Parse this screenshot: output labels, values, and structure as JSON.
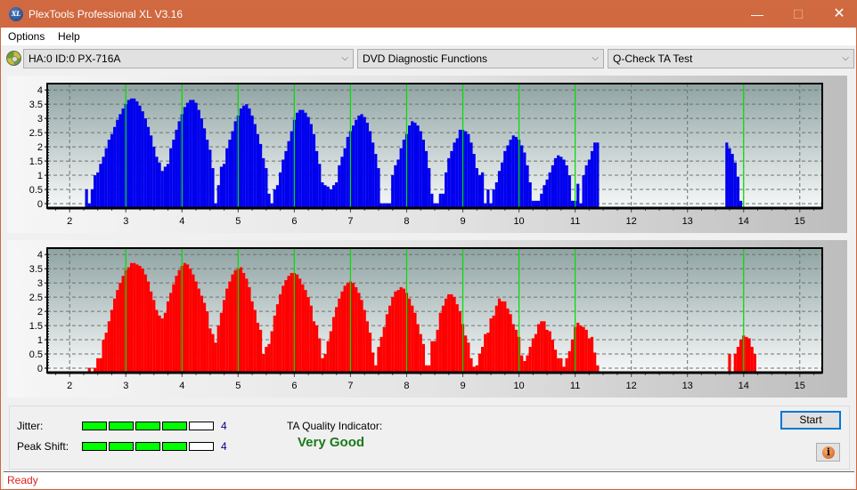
{
  "window": {
    "title": "PlexTools Professional XL V3.16",
    "app_icon": "xl-logo-icon",
    "controls": {
      "minimize": "—",
      "maximize": "☐",
      "close": "✕"
    }
  },
  "menu": {
    "items": [
      "Options",
      "Help"
    ]
  },
  "toolbar": {
    "drive_icon": "cd-drive-icon",
    "drive_select": "HA:0 ID:0  PX-716A",
    "function_select": "DVD Diagnostic Functions",
    "test_select": "Q-Check TA Test",
    "chevron": "⌵"
  },
  "colors": {
    "titlebar": "#d06840",
    "top_bars": "#0000ee",
    "bottom_bars": "#ff0000",
    "marker_lines": "#00e000",
    "meter_on": "#00ff00",
    "quality_text": "#1a7a1a",
    "status_text": "#e02020"
  },
  "chart_data": [
    {
      "type": "bar",
      "name": "ta-top-chart",
      "title": "",
      "xlabel": "",
      "ylabel": "",
      "xlim": [
        1.6,
        15.4
      ],
      "ylim": [
        -0.1,
        4.1
      ],
      "xticks": [
        2,
        3,
        4,
        5,
        6,
        7,
        8,
        9,
        10,
        11,
        12,
        13,
        14,
        15
      ],
      "yticks": [
        0,
        0.5,
        1,
        1.5,
        2,
        2.5,
        3,
        3.5,
        4
      ],
      "ytick_labels": [
        "0",
        "0.5",
        "1",
        "1.5",
        "2",
        "2.5",
        "3",
        "3.5",
        "4"
      ],
      "grid": true,
      "marker_lines": [
        3,
        4,
        5,
        6,
        7,
        8,
        9,
        10,
        11,
        14
      ],
      "bar_color": "#0000ee",
      "x": [
        2.3,
        2.35,
        2.4,
        2.45,
        2.5,
        2.55,
        2.6,
        2.65,
        2.7,
        2.75,
        2.8,
        2.85,
        2.9,
        2.95,
        3.0,
        3.05,
        3.1,
        3.15,
        3.2,
        3.25,
        3.3,
        3.35,
        3.4,
        3.45,
        3.5,
        3.55,
        3.6,
        3.65,
        3.7,
        3.75,
        3.8,
        3.85,
        3.9,
        3.95,
        4.0,
        4.05,
        4.1,
        4.15,
        4.2,
        4.25,
        4.3,
        4.35,
        4.4,
        4.45,
        4.5,
        4.55,
        4.6,
        4.65,
        4.7,
        4.75,
        4.8,
        4.85,
        4.9,
        4.95,
        5.0,
        5.05,
        5.1,
        5.15,
        5.2,
        5.25,
        5.3,
        5.35,
        5.4,
        5.45,
        5.5,
        5.55,
        5.6,
        5.65,
        5.7,
        5.75,
        5.8,
        5.85,
        5.9,
        5.95,
        6.0,
        6.05,
        6.1,
        6.15,
        6.2,
        6.25,
        6.3,
        6.35,
        6.4,
        6.45,
        6.5,
        6.55,
        6.6,
        6.65,
        6.7,
        6.75,
        6.8,
        6.85,
        6.9,
        6.95,
        7.0,
        7.05,
        7.1,
        7.15,
        7.2,
        7.25,
        7.3,
        7.35,
        7.4,
        7.45,
        7.5,
        7.55,
        7.6,
        7.65,
        7.7,
        7.75,
        7.8,
        7.85,
        7.9,
        7.95,
        8.0,
        8.05,
        8.1,
        8.15,
        8.2,
        8.25,
        8.3,
        8.35,
        8.4,
        8.45,
        8.5,
        8.55,
        8.6,
        8.65,
        8.7,
        8.75,
        8.8,
        8.85,
        8.9,
        8.95,
        9.0,
        9.05,
        9.1,
        9.15,
        9.2,
        9.25,
        9.3,
        9.35,
        9.4,
        9.45,
        9.5,
        9.55,
        9.6,
        9.65,
        9.7,
        9.75,
        9.8,
        9.85,
        9.9,
        9.95,
        10.0,
        10.05,
        10.1,
        10.15,
        10.2,
        10.25,
        10.3,
        10.35,
        10.4,
        10.45,
        10.5,
        10.55,
        10.6,
        10.65,
        10.7,
        10.75,
        10.8,
        10.85,
        10.9,
        10.95,
        11.0,
        11.05,
        11.1,
        11.15,
        11.2,
        11.25,
        11.3,
        11.35,
        11.4,
        13.7,
        13.75,
        13.8,
        13.85,
        13.9,
        13.95,
        14.0,
        14.05,
        14.1,
        14.15,
        14.2,
        14.25,
        14.3,
        14.35,
        14.4
      ],
      "values": [
        0.5,
        0,
        0.5,
        1,
        1.1,
        1.4,
        1.65,
        1.95,
        2.25,
        2.45,
        2.7,
        2.95,
        3.15,
        3.35,
        3.5,
        3.65,
        3.7,
        3.7,
        3.6,
        3.45,
        3.25,
        3.0,
        2.7,
        2.4,
        2.0,
        1.65,
        1.45,
        1.15,
        1.3,
        1.4,
        1.95,
        2.25,
        2.6,
        2.9,
        3.15,
        3.4,
        3.55,
        3.65,
        3.65,
        3.55,
        3.3,
        3.0,
        2.65,
        2.25,
        1.9,
        1.25,
        0,
        0.65,
        1.3,
        1.4,
        1.95,
        2.25,
        2.55,
        2.9,
        3.1,
        3.35,
        3.45,
        3.5,
        3.35,
        3.1,
        2.8,
        2.45,
        2.1,
        1.6,
        1.25,
        0.35,
        0,
        0.5,
        0.65,
        1.1,
        1.55,
        1.85,
        2.2,
        2.55,
        2.95,
        3.2,
        3.3,
        3.3,
        3.2,
        3.05,
        2.8,
        2.45,
        1.85,
        1.4,
        0.75,
        0.65,
        0.6,
        0.5,
        0.65,
        0.75,
        1.35,
        1.65,
        1.95,
        2.35,
        2.55,
        2.75,
        2.95,
        3.1,
        3.15,
        3.05,
        2.85,
        2.55,
        2.15,
        1.75,
        1.25,
        0,
        0,
        0,
        0,
        1.0,
        1.35,
        1.55,
        1.95,
        2.25,
        2.45,
        2.75,
        2.9,
        2.85,
        2.75,
        2.55,
        2.25,
        1.85,
        1.25,
        0.35,
        0,
        0,
        0.35,
        0.35,
        1.1,
        1.6,
        1.85,
        2.15,
        2.3,
        2.6,
        2.6,
        2.55,
        2.45,
        2.15,
        1.75,
        1.25,
        1.0,
        1.1,
        0,
        0.5,
        0,
        0.5,
        0.75,
        1.15,
        1.45,
        1.85,
        2.05,
        2.25,
        2.4,
        2.35,
        2.25,
        2.05,
        1.8,
        1.35,
        0.75,
        0.1,
        0.1,
        0.1,
        0.35,
        0.65,
        0.85,
        1.1,
        1.35,
        1.6,
        1.7,
        1.65,
        1.55,
        1.35,
        1.0,
        0.1,
        0.1,
        0.7,
        0,
        1.0,
        1.35,
        1.55,
        1.85,
        2.15,
        2.15,
        2.15,
        1.95,
        1.75,
        1.45,
        0.95,
        0.1
      ]
    },
    {
      "type": "bar",
      "name": "ta-bottom-chart",
      "title": "",
      "xlabel": "",
      "ylabel": "",
      "xlim": [
        1.6,
        15.4
      ],
      "ylim": [
        -0.1,
        4.1
      ],
      "xticks": [
        2,
        3,
        4,
        5,
        6,
        7,
        8,
        9,
        10,
        11,
        12,
        13,
        14,
        15
      ],
      "yticks": [
        0,
        0.5,
        1,
        1.5,
        2,
        2.5,
        3,
        3.5,
        4
      ],
      "ytick_labels": [
        "0",
        "0.5",
        "1",
        "1.5",
        "2",
        "2.5",
        "3",
        "3.5",
        "4"
      ],
      "grid": true,
      "marker_lines": [
        3,
        4,
        5,
        6,
        7,
        8,
        9,
        10,
        11,
        14
      ],
      "bar_color": "#ff0000",
      "x": [
        2.35,
        2.45,
        2.5,
        2.55,
        2.6,
        2.65,
        2.7,
        2.75,
        2.8,
        2.85,
        2.9,
        2.95,
        3.0,
        3.05,
        3.1,
        3.15,
        3.2,
        3.25,
        3.3,
        3.35,
        3.4,
        3.45,
        3.5,
        3.55,
        3.6,
        3.65,
        3.7,
        3.75,
        3.8,
        3.85,
        3.9,
        3.95,
        4.0,
        4.05,
        4.1,
        4.15,
        4.2,
        4.25,
        4.3,
        4.35,
        4.4,
        4.45,
        4.5,
        4.55,
        4.6,
        4.65,
        4.7,
        4.75,
        4.8,
        4.85,
        4.9,
        4.95,
        5.0,
        5.05,
        5.1,
        5.15,
        5.2,
        5.25,
        5.3,
        5.35,
        5.4,
        5.45,
        5.5,
        5.55,
        5.6,
        5.65,
        5.7,
        5.75,
        5.8,
        5.85,
        5.9,
        5.95,
        6.0,
        6.05,
        6.1,
        6.15,
        6.2,
        6.25,
        6.3,
        6.35,
        6.4,
        6.45,
        6.5,
        6.55,
        6.6,
        6.65,
        6.7,
        6.75,
        6.8,
        6.85,
        6.9,
        6.95,
        7.0,
        7.05,
        7.1,
        7.15,
        7.2,
        7.25,
        7.3,
        7.35,
        7.4,
        7.45,
        7.5,
        7.55,
        7.6,
        7.65,
        7.7,
        7.75,
        7.8,
        7.85,
        7.9,
        7.95,
        8.0,
        8.05,
        8.1,
        8.15,
        8.2,
        8.25,
        8.3,
        8.35,
        8.4,
        8.45,
        8.5,
        8.55,
        8.6,
        8.65,
        8.7,
        8.75,
        8.8,
        8.85,
        8.9,
        8.95,
        9.0,
        9.05,
        9.1,
        9.15,
        9.2,
        9.25,
        9.3,
        9.35,
        9.4,
        9.45,
        9.5,
        9.55,
        9.6,
        9.65,
        9.7,
        9.75,
        9.8,
        9.85,
        9.9,
        9.95,
        10.0,
        10.05,
        10.1,
        10.15,
        10.2,
        10.25,
        10.3,
        10.35,
        10.4,
        10.45,
        10.5,
        10.55,
        10.6,
        10.65,
        10.7,
        10.75,
        10.8,
        10.85,
        10.9,
        10.95,
        11.0,
        11.05,
        11.1,
        11.15,
        11.2,
        11.25,
        11.3,
        11.35,
        11.4,
        13.75,
        13.85,
        13.9,
        13.95,
        14.0,
        14.05,
        14.1,
        14.15,
        14.2,
        14.25
      ],
      "values": [
        0,
        0,
        0.35,
        0.35,
        1.0,
        1.25,
        1.65,
        2.05,
        2.45,
        2.75,
        3.0,
        3.25,
        3.45,
        3.55,
        3.7,
        3.7,
        3.65,
        3.6,
        3.5,
        3.3,
        3.05,
        2.7,
        2.4,
        2.05,
        1.85,
        1.75,
        1.95,
        2.35,
        2.65,
        2.95,
        3.25,
        3.45,
        3.6,
        3.7,
        3.65,
        3.5,
        3.3,
        3.05,
        2.8,
        2.55,
        2.3,
        2.0,
        1.4,
        1.2,
        0.9,
        1.5,
        1.95,
        2.4,
        2.8,
        3.05,
        3.3,
        3.45,
        3.5,
        3.55,
        3.35,
        3.15,
        2.85,
        2.35,
        2.05,
        1.6,
        1.35,
        0.5,
        0.75,
        0.85,
        1.3,
        1.85,
        2.25,
        2.6,
        2.9,
        3.1,
        3.25,
        3.35,
        3.35,
        3.3,
        3.15,
        2.95,
        2.75,
        2.5,
        2.2,
        1.65,
        1.5,
        1.05,
        0.35,
        0.5,
        0.95,
        1.3,
        1.8,
        2.15,
        2.45,
        2.7,
        2.9,
        3.0,
        3.05,
        3.0,
        2.85,
        2.65,
        2.4,
        2.05,
        1.65,
        1.25,
        0.55,
        0.1,
        0.75,
        1.1,
        1.45,
        1.9,
        2.2,
        2.5,
        2.7,
        2.75,
        2.85,
        2.8,
        2.65,
        2.45,
        2.2,
        1.95,
        1.55,
        1.2,
        0.85,
        0.1,
        0.1,
        0.95,
        0.95,
        1.35,
        1.95,
        2.2,
        2.45,
        2.6,
        2.6,
        2.5,
        2.25,
        2.0,
        1.55,
        1.15,
        0.9,
        0.35,
        0.05,
        0.1,
        0.5,
        0.75,
        1.2,
        1.25,
        1.75,
        1.85,
        2.2,
        2.45,
        2.35,
        2.35,
        2.1,
        1.9,
        1.55,
        1.35,
        1.1,
        0.45,
        0.25,
        0.45,
        0.75,
        1.05,
        1.2,
        1.55,
        1.65,
        1.65,
        1.35,
        1.3,
        1.0,
        0.65,
        0.35,
        0.35,
        0.05,
        0.35,
        0.6,
        1.0,
        1.45,
        1.6,
        1.5,
        1.45,
        1.35,
        1.05,
        1.1,
        0.55,
        0.1,
        0.5,
        0.5,
        0.75,
        1.0,
        1.15,
        1.1,
        1.05,
        0.75,
        0.5
      ]
    }
  ],
  "metrics": {
    "jitter": {
      "label": "Jitter:",
      "value": "4",
      "level": 4,
      "max": 5
    },
    "peak_shift": {
      "label": "Peak Shift:",
      "value": "4",
      "level": 4,
      "max": 5
    }
  },
  "quality": {
    "label": "TA Quality Indicator:",
    "value": "Very Good"
  },
  "buttons": {
    "start": "Start",
    "info_icon": "info-icon",
    "info_glyph": "i"
  },
  "status": {
    "text": "Ready"
  }
}
